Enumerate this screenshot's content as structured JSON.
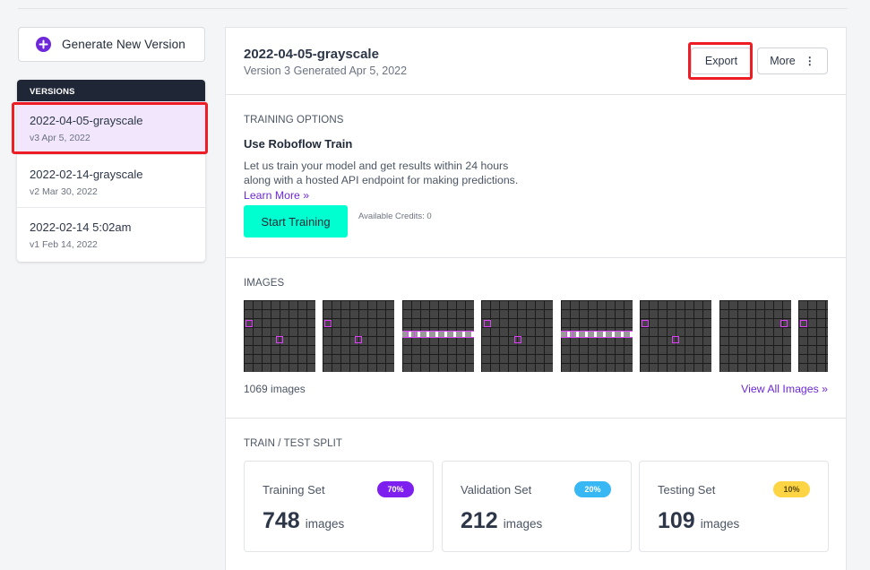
{
  "sidebar": {
    "generate_label": "Generate New Version",
    "versions_header": "VERSIONS",
    "versions": [
      {
        "name": "2022-04-05-grayscale",
        "sub": "v3 Apr 5, 2022"
      },
      {
        "name": "2022-02-14-grayscale",
        "sub": "v2 Mar 30, 2022"
      },
      {
        "name": "2022-02-14 5:02am",
        "sub": "v1 Feb 14, 2022"
      }
    ]
  },
  "header": {
    "title": "2022-04-05-grayscale",
    "subtitle": "Version 3 Generated Apr 5, 2022",
    "export_label": "Export",
    "more_label": "More",
    "more_icon": "⋮"
  },
  "training": {
    "caption": "TRAINING OPTIONS",
    "heading": "Use Roboflow Train",
    "description": "Let us train your model and get results within 24 hours along with a hosted API endpoint for making predictions.",
    "learn_more": "Learn More »",
    "start_label": "Start Training",
    "credits": "Available Credits: 0"
  },
  "images": {
    "caption": "IMAGES",
    "count": "1069 images",
    "view_all": "View All Images »"
  },
  "split": {
    "caption": "TRAIN / TEST SPLIT",
    "cards": [
      {
        "name": "Training Set",
        "percent": "70%",
        "count": "748",
        "unit": "images",
        "pill_color": "#7c1fef",
        "pill_text_color": "#ffffff"
      },
      {
        "name": "Validation Set",
        "percent": "20%",
        "count": "212",
        "unit": "images",
        "pill_color": "#38b7f5",
        "pill_text_color": "#ffffff"
      },
      {
        "name": "Testing Set",
        "percent": "10%",
        "count": "109",
        "unit": "images",
        "pill_color": "#fdd444",
        "pill_text_color": "#5a4a10"
      }
    ]
  },
  "colors": {
    "accent": "#6d28d9",
    "start_button": "#00ffd0",
    "highlight": "#ee1c25",
    "active_version_bg": "#f1e6fb"
  }
}
